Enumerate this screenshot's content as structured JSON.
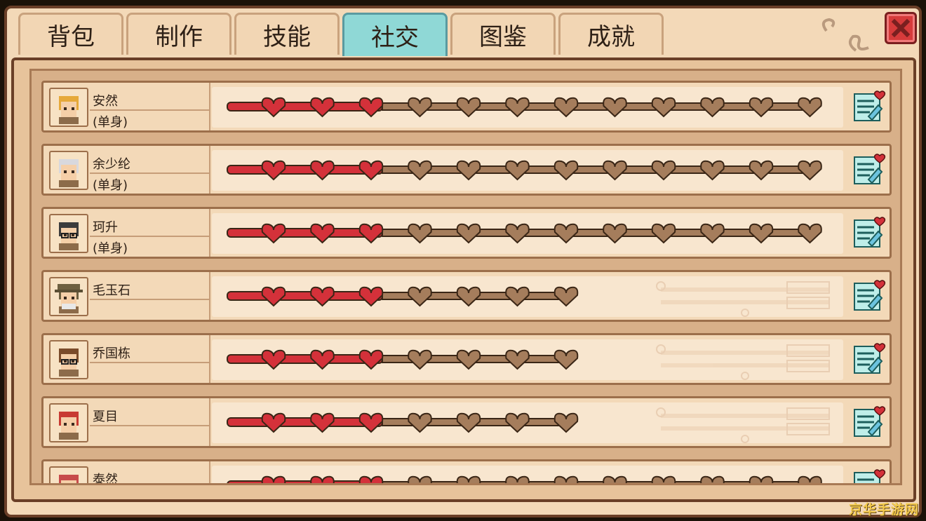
{
  "tabs": [
    {
      "label": "背包",
      "active": false
    },
    {
      "label": "制作",
      "active": false
    },
    {
      "label": "技能",
      "active": false
    },
    {
      "label": "社交",
      "active": true
    },
    {
      "label": "图鉴",
      "active": false
    },
    {
      "label": "成就",
      "active": false
    }
  ],
  "close_icon": "close-icon",
  "npcs": [
    {
      "name": "安然",
      "status": "(单身)",
      "hearts_filled": 3,
      "hearts_total": 12,
      "avatar": "blonde-girl-avatar"
    },
    {
      "name": "余少纶",
      "status": "(单身)",
      "hearts_filled": 3,
      "hearts_total": 12,
      "avatar": "silver-hair-boy-avatar"
    },
    {
      "name": "珂升",
      "status": "(单身)",
      "hearts_filled": 3,
      "hearts_total": 12,
      "avatar": "glasses-boy-avatar"
    },
    {
      "name": "毛玉石",
      "status": "",
      "hearts_filled": 3,
      "hearts_total": 7,
      "avatar": "hat-old-man-avatar"
    },
    {
      "name": "乔国栋",
      "status": "",
      "hearts_filled": 3,
      "hearts_total": 7,
      "avatar": "glasses-man-avatar"
    },
    {
      "name": "夏目",
      "status": "",
      "hearts_filled": 3,
      "hearts_total": 7,
      "avatar": "red-cap-kid-avatar"
    },
    {
      "name": "泰然",
      "status": "",
      "hearts_filled": 3,
      "hearts_total": 12,
      "avatar": "red-hat-avatar"
    }
  ],
  "colors": {
    "heart_filled": "#d4313a",
    "heart_empty": "#a57d5c",
    "accent_tab": "#8fd8d6"
  },
  "watermark": "京华手游网"
}
